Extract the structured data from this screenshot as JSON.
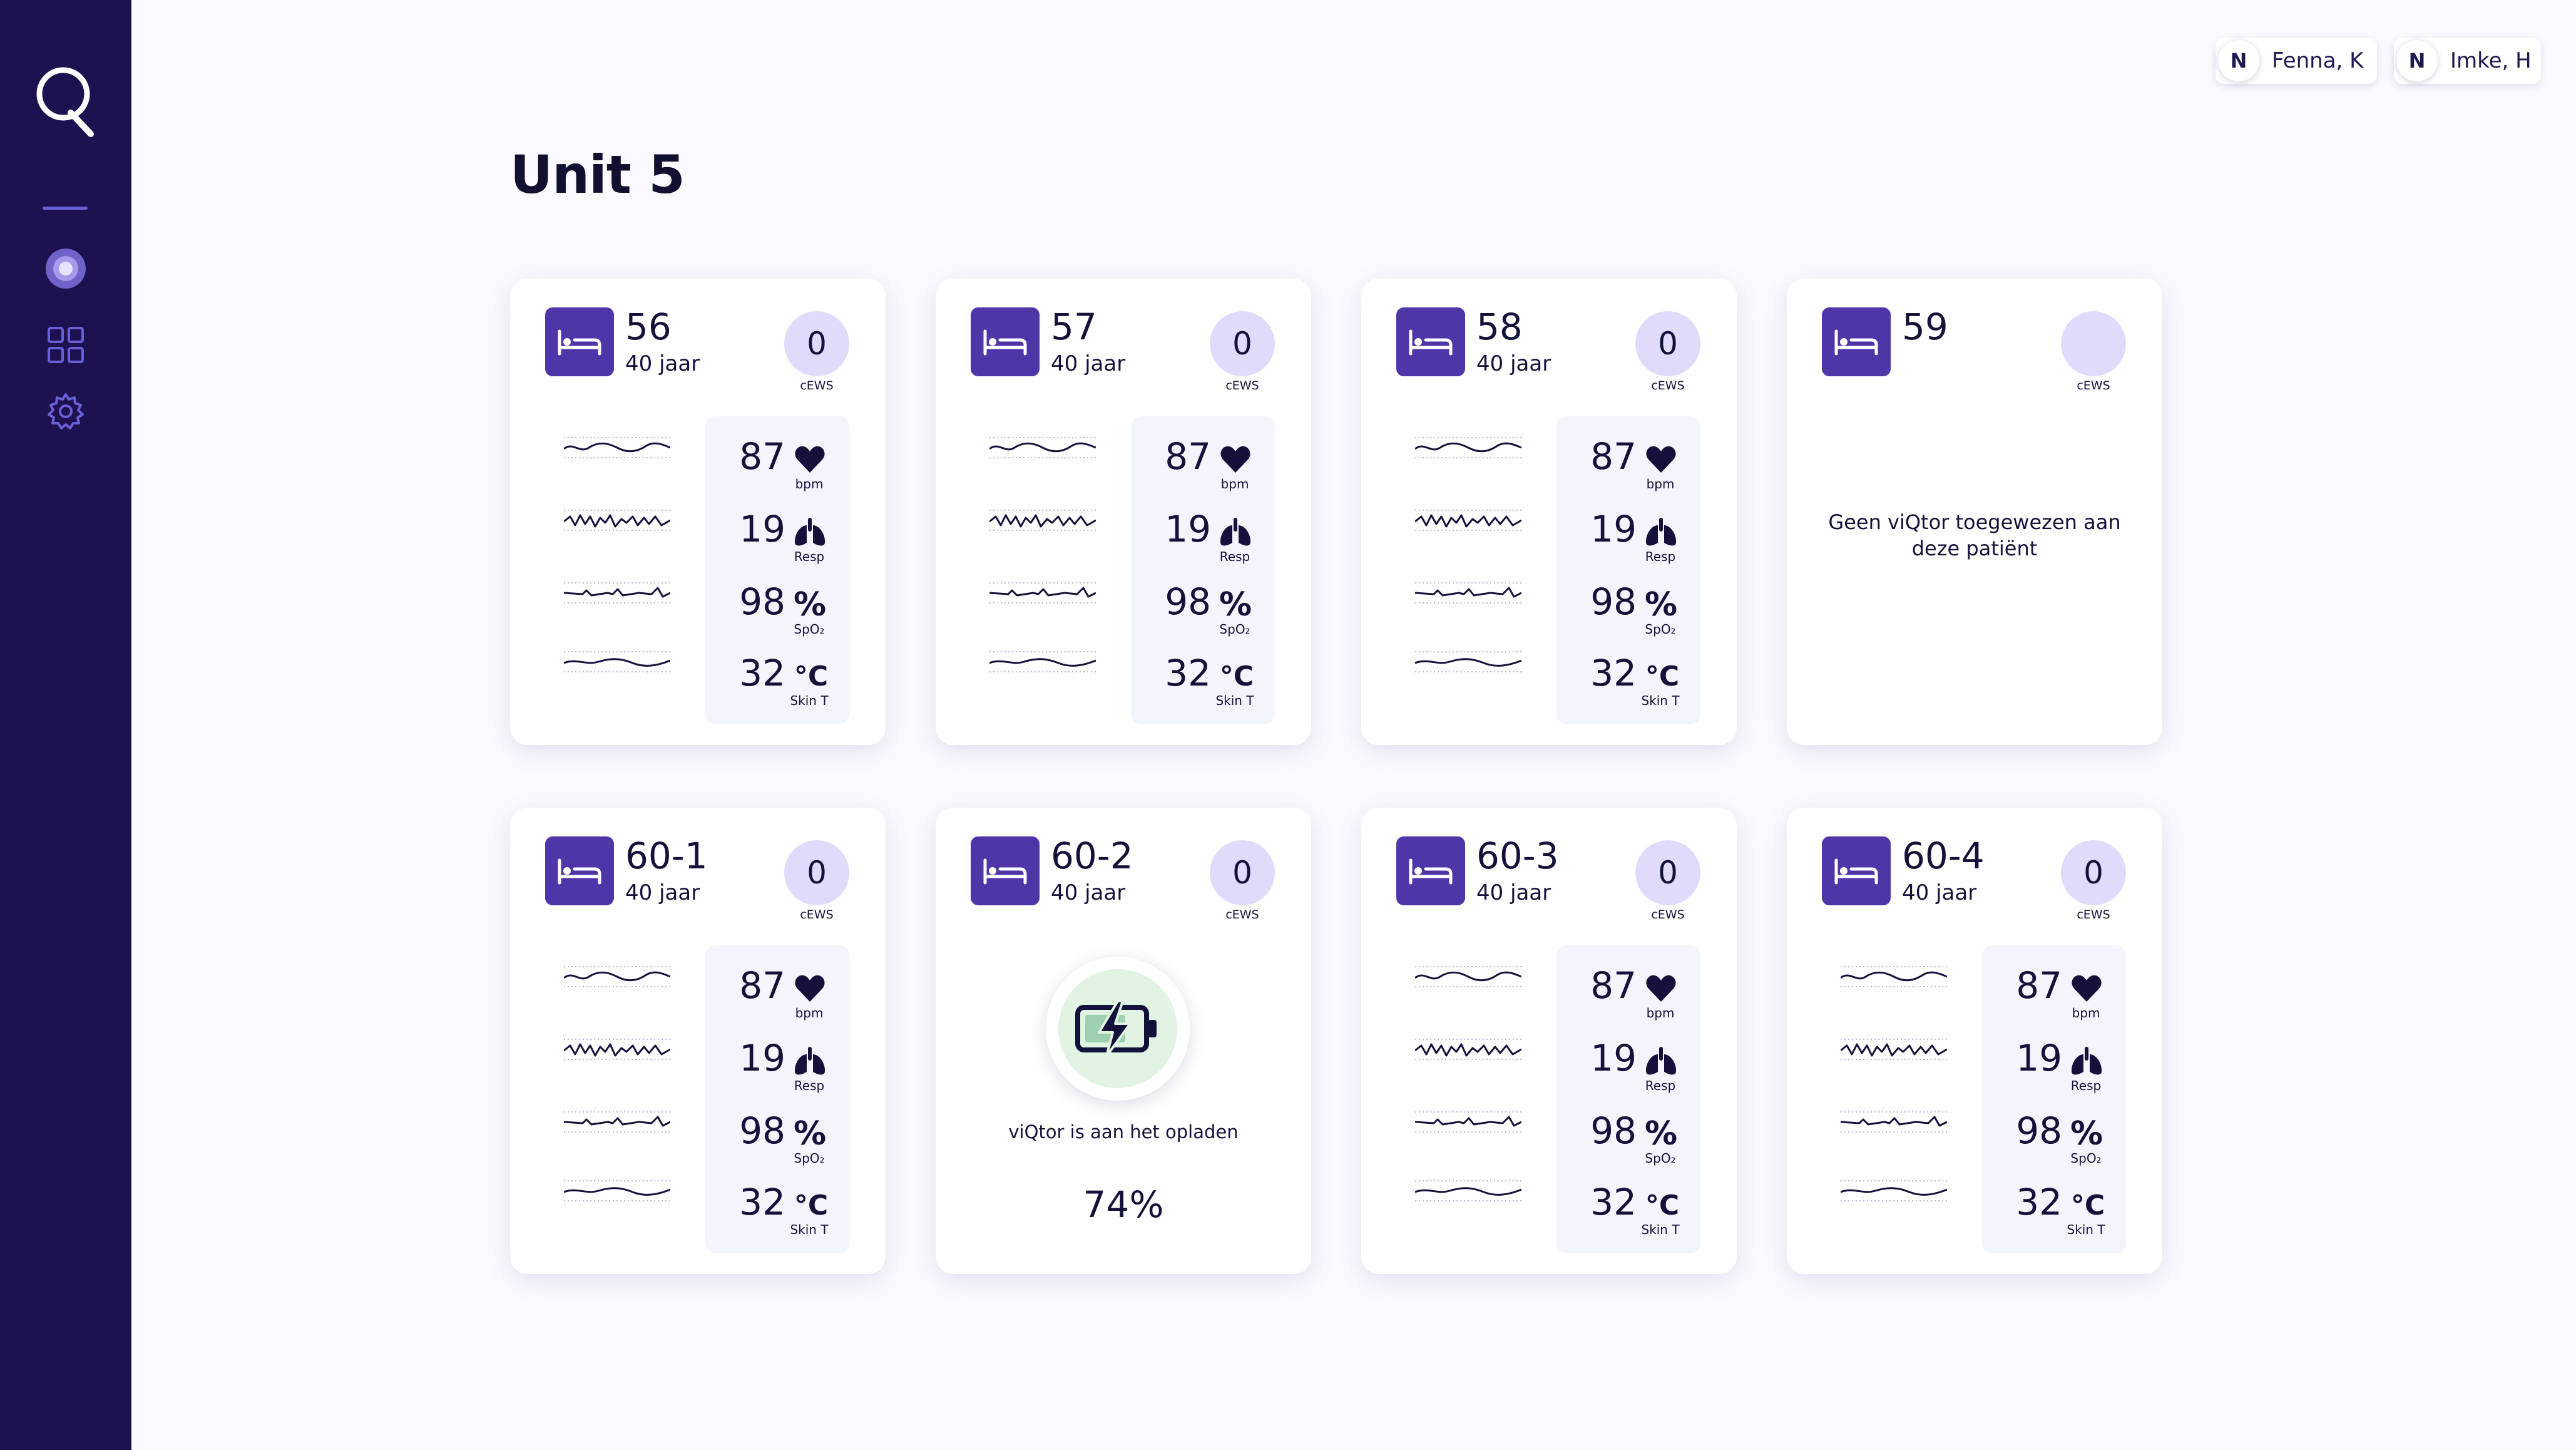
{
  "app": {
    "logo_icon": "viqtor-q-logo"
  },
  "sidebar": {
    "items": [
      "user-avatar-icon",
      "dashboard-grid-icon",
      "settings-gear-icon"
    ]
  },
  "users": [
    {
      "initial": "N",
      "name": "Fenna, K"
    },
    {
      "initial": "N",
      "name": "Imke, H"
    }
  ],
  "page": {
    "title": "Unit 5"
  },
  "labels": {
    "cews": "cEWS",
    "bpm": "bpm",
    "resp": "Resp",
    "spo2": "SpO₂",
    "skin": "Skin T",
    "percent_symbol": "%",
    "celsius_symbol": "°C"
  },
  "colors": {
    "sidebar": "#1e1150",
    "accent": "#4e35a8",
    "cews_bg": "#e0dbfb",
    "charging_bg": "#e1f3e2",
    "charging_icon": "#1c8f4e"
  },
  "cards": [
    {
      "room": "56",
      "age": "40 jaar",
      "cews": "0",
      "status": "active",
      "vitals": {
        "hr": "87",
        "resp": "19",
        "spo2": "98",
        "temp": "32"
      }
    },
    {
      "room": "57",
      "age": "40 jaar",
      "cews": "0",
      "status": "active",
      "vitals": {
        "hr": "87",
        "resp": "19",
        "spo2": "98",
        "temp": "32"
      }
    },
    {
      "room": "58",
      "age": "40 jaar",
      "cews": "0",
      "status": "active",
      "vitals": {
        "hr": "87",
        "resp": "19",
        "spo2": "98",
        "temp": "32"
      }
    },
    {
      "room": "59",
      "age": "",
      "cews": "",
      "status": "unassigned",
      "message": "Geen viQtor toegewezen aan deze patiënt"
    },
    {
      "room": "60-1",
      "age": "40 jaar",
      "cews": "0",
      "status": "active",
      "vitals": {
        "hr": "87",
        "resp": "19",
        "spo2": "98",
        "temp": "32"
      }
    },
    {
      "room": "60-2",
      "age": "40 jaar",
      "cews": "0",
      "status": "charging",
      "message": "viQtor is aan het opladen",
      "battery": "74%",
      "battery_level": 0.74
    },
    {
      "room": "60-3",
      "age": "40 jaar",
      "cews": "0",
      "status": "active",
      "vitals": {
        "hr": "87",
        "resp": "19",
        "spo2": "98",
        "temp": "32"
      }
    },
    {
      "room": "60-4",
      "age": "40 jaar",
      "cews": "0",
      "status": "active",
      "vitals": {
        "hr": "87",
        "resp": "19",
        "spo2": "98",
        "temp": "32"
      }
    }
  ]
}
